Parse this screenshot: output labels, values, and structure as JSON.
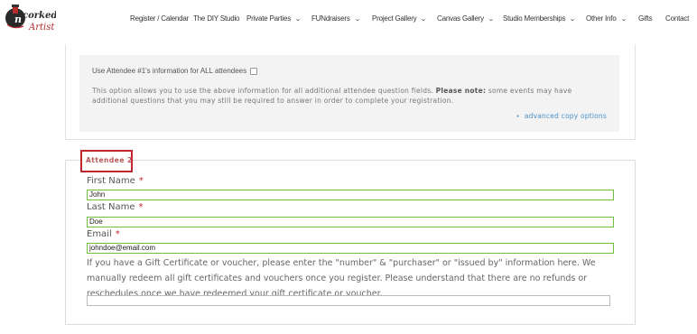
{
  "header": {
    "logo_text": "Uncorked Artist",
    "nav": [
      {
        "label": "Register / Calendar",
        "dropdown": false
      },
      {
        "label": "The DIY Studio",
        "dropdown": false
      },
      {
        "label": "Private Parties",
        "dropdown": true
      },
      {
        "label": "FUNdraisers",
        "dropdown": true
      },
      {
        "label": "Project Gallery",
        "dropdown": true
      },
      {
        "label": "Canvas Gallery",
        "dropdown": true
      },
      {
        "label": "Studio Memberships",
        "dropdown": true
      },
      {
        "label": "Other Info",
        "dropdown": true
      },
      {
        "label": "Gifts",
        "dropdown": false
      },
      {
        "label": "Contact",
        "dropdown": false
      }
    ]
  },
  "copy_panel": {
    "checkbox_label": "Use Attendee #1's information for ALL attendees",
    "checked": false,
    "desc_part1": "This option allows you to use the above information for all additional attendee question fields.",
    "desc_bold": "Please note:",
    "desc_part2": "some events may have additional questions that you may still be required to answer in order to complete your registration.",
    "advanced_link": "advanced copy options"
  },
  "attendee": {
    "legend": "Attendee 2",
    "required_mark": "*",
    "first_name_label": "First Name",
    "first_name_value": "John",
    "last_name_label": "Last Name",
    "last_name_value": "Doe",
    "email_label": "Email",
    "email_value": "johndoe@email.com",
    "gift_text": "If you have a Gift Certificate or voucher, please enter the \"number\" & \"purchaser\" or \"issued by\" information here. We manually redeem all gift certificates and vouchers once you register. Please understand that there are no refunds or reschedules once we have redeemed your gift certificate or voucher.",
    "gift_value": ""
  },
  "colors": {
    "required": "#c0272d",
    "valid_border": "#6fbf3b",
    "link": "#4a90c8"
  }
}
